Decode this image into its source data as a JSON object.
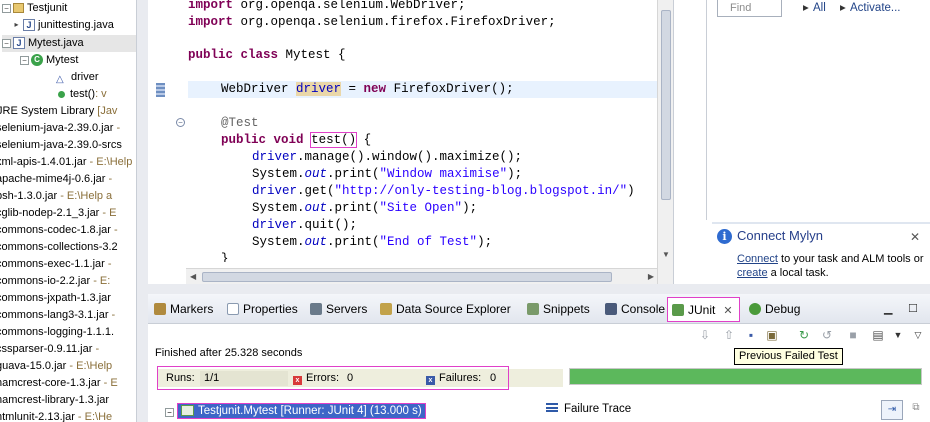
{
  "explorer": {
    "project": "Testjunit",
    "items": [
      {
        "label": "junittesting.java",
        "suffix": ""
      },
      {
        "label": "Mytest.java",
        "suffix": ""
      },
      {
        "label": "Mytest",
        "suffix": ""
      },
      {
        "label": "driver",
        "suffix": ""
      },
      {
        "label": "test()",
        "suffix": ": v"
      },
      {
        "label": "JRE System Library",
        "suffix": " [Jav"
      },
      {
        "label": "selenium-java-2.39.0.jar",
        "suffix": " -"
      },
      {
        "label": "selenium-java-2.39.0-srcs",
        "suffix": ""
      },
      {
        "label": "xml-apis-1.4.01.jar",
        "suffix": " - E:\\Help"
      },
      {
        "label": "apache-mime4j-0.6.jar",
        "suffix": " -"
      },
      {
        "label": "bsh-1.3.0.jar",
        "suffix": " - E:\\Help a"
      },
      {
        "label": "cglib-nodep-2.1_3.jar",
        "suffix": " - E"
      },
      {
        "label": "commons-codec-1.8.jar",
        "suffix": " -"
      },
      {
        "label": "commons-collections-3.2",
        "suffix": ""
      },
      {
        "label": "commons-exec-1.1.jar",
        "suffix": " -"
      },
      {
        "label": "commons-io-2.2.jar",
        "suffix": " - E:"
      },
      {
        "label": "commons-jxpath-1.3.jar",
        "suffix": ""
      },
      {
        "label": "commons-lang3-3.1.jar",
        "suffix": " -"
      },
      {
        "label": "commons-logging-1.1.1.",
        "suffix": ""
      },
      {
        "label": "cssparser-0.9.11.jar",
        "suffix": " -"
      },
      {
        "label": "guava-15.0.jar",
        "suffix": " - E:\\Help"
      },
      {
        "label": "hamcrest-core-1.3.jar",
        "suffix": " - E"
      },
      {
        "label": "hamcrest-library-1.3.jar",
        "suffix": ""
      },
      {
        "label": "htmlunit-2.13.jar",
        "suffix": " - E:\\He"
      }
    ]
  },
  "editor": {
    "lines": {
      "import1_kw": "import",
      "import1_rest": " org.openqa.selenium.WebDriver;",
      "import2_kw": "import",
      "import2_rest": " org.openqa.selenium.firefox.FirefoxDriver;",
      "class_kw1": "public",
      "class_kw2": "class",
      "class_name": " Mytest {",
      "field_type": "WebDriver ",
      "field_var": "driver",
      "field_eq": " = ",
      "field_new": "new",
      "field_rest": " FirefoxDriver();",
      "annotation": "@Test",
      "method_kw1": "public",
      "method_kw2": "void",
      "method_name": "test()",
      "method_brace": " {",
      "l1_var": "driver",
      "l1_rest": ".manage().window().maximize();",
      "l2_pre": "System.",
      "l2_out": "out",
      "l2_mid": ".print(",
      "l2_str": "\"Window maximise\"",
      "l2_end": ");",
      "l3_var": "driver",
      "l3_mid": ".get(",
      "l3_str": "\"http://only-testing-blog.blogspot.in/\"",
      "l3_end": ")",
      "l4_pre": "System.",
      "l4_out": "out",
      "l4_mid": ".print(",
      "l4_str": "\"Site Open\"",
      "l4_end": ");",
      "l5_var": "driver",
      "l5_rest": ".quit();",
      "l6_pre": "System.",
      "l6_out": "out",
      "l6_mid": ".print(",
      "l6_str": "\"End of Test\"",
      "l6_end": ");",
      "close": "}"
    }
  },
  "search": {
    "placeholder": "Find",
    "all": "All",
    "activate": "Activate..."
  },
  "mylyn": {
    "title": "Connect Mylyn",
    "connect": "Connect",
    "text1": " to your task and ALM tools or",
    "create": "create",
    "text2": " a local task."
  },
  "views": {
    "tabs": [
      {
        "label": "Markers",
        "icon": "markers-icon",
        "color": "#b08a3e"
      },
      {
        "label": "Properties",
        "icon": "properties-icon",
        "color": "#8a9ab0"
      },
      {
        "label": "Servers",
        "icon": "servers-icon",
        "color": "#6a7a8a"
      },
      {
        "label": "Data Source Explorer",
        "icon": "database-icon",
        "color": "#c2a24a"
      },
      {
        "label": "Snippets",
        "icon": "snippets-icon",
        "color": "#7a9a6a"
      },
      {
        "label": "Console",
        "icon": "console-icon",
        "color": "#4a5a7a"
      },
      {
        "label": "JUnit",
        "icon": "junit-icon",
        "color": "#5a9a4a"
      },
      {
        "label": "Debug",
        "icon": "debug-icon",
        "color": "#4a9a3a"
      }
    ],
    "junit": {
      "status": "Finished after 25.328 seconds",
      "tooltip": "Previous Failed Test",
      "runs_label": "Runs:",
      "runs_value": "1/1",
      "errors_label": "Errors:",
      "errors_value": "0",
      "failures_label": "Failures:",
      "failures_value": "0",
      "progress": 1.0,
      "progress_color": "#5cb85c",
      "suite": "Testjunit.Mytest [Runner: JUnit 4] (13.000 s)",
      "failure_trace": "Failure Trace"
    }
  }
}
